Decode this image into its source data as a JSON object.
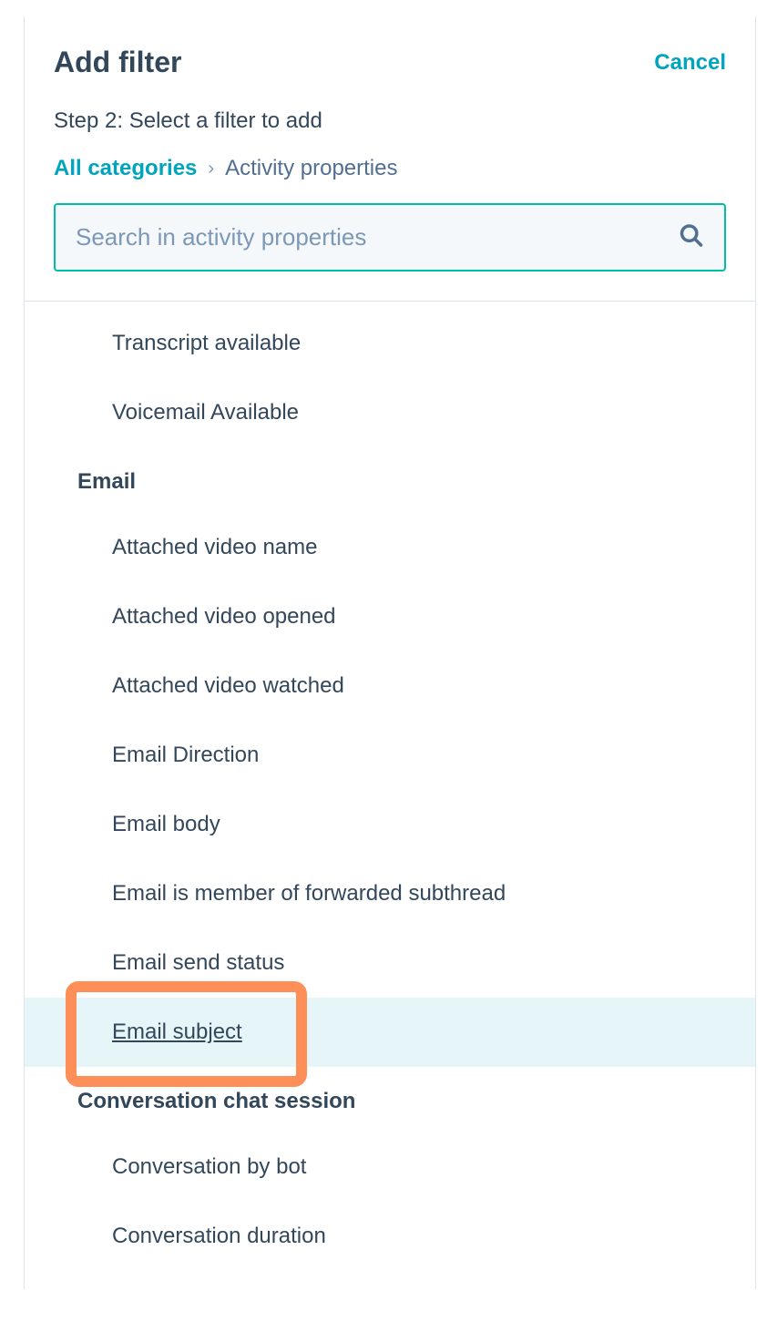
{
  "header": {
    "title": "Add filter",
    "cancel": "Cancel",
    "step_text": "Step 2: Select a filter to add"
  },
  "breadcrumb": {
    "all_categories": "All categories",
    "separator": "›",
    "current": "Activity properties"
  },
  "search": {
    "placeholder": "Search in activity properties"
  },
  "items": {
    "transcript_available": "Transcript available",
    "voicemail_available": "Voicemail Available",
    "email_group": "Email",
    "attached_video_name": "Attached video name",
    "attached_video_opened": "Attached video opened",
    "attached_video_watched": "Attached video watched",
    "email_direction": "Email Direction",
    "email_body": "Email body",
    "email_forwarded": "Email is member of forwarded subthread",
    "email_send_status": "Email send status",
    "email_subject": "Email subject",
    "chat_group": "Conversation chat session",
    "conversation_by_bot": "Conversation by bot",
    "conversation_duration": "Conversation duration"
  }
}
